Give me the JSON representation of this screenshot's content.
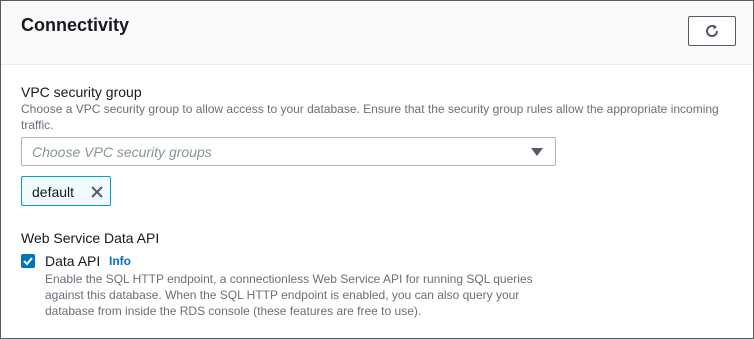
{
  "panel": {
    "title": "Connectivity",
    "refresh_icon": "refresh-icon"
  },
  "vpc": {
    "label": "VPC security group",
    "description_line1": "Choose a VPC security group to allow access to your database. Ensure that the security group rules allow the appropriate incoming",
    "description_line2": "traffic.",
    "placeholder": "Choose VPC security groups",
    "caret_icon": "caret-down-icon",
    "selected_token": "default",
    "token_remove_icon": "close-icon"
  },
  "data_api": {
    "section_label": "Web Service Data API",
    "checkbox_label": "Data API",
    "checked": true,
    "info_link": "Info",
    "description_line1": "Enable the SQL HTTP endpoint, a connectionless Web Service API for running SQL queries",
    "description_line2": "against this database. When the SQL HTTP endpoint is enabled, you can also query your",
    "description_line3": "database from inside the RDS console (these features are free to use)."
  },
  "colors": {
    "accent": "#0073bb",
    "token_border": "#00a1c9",
    "muted_text": "#687078"
  }
}
